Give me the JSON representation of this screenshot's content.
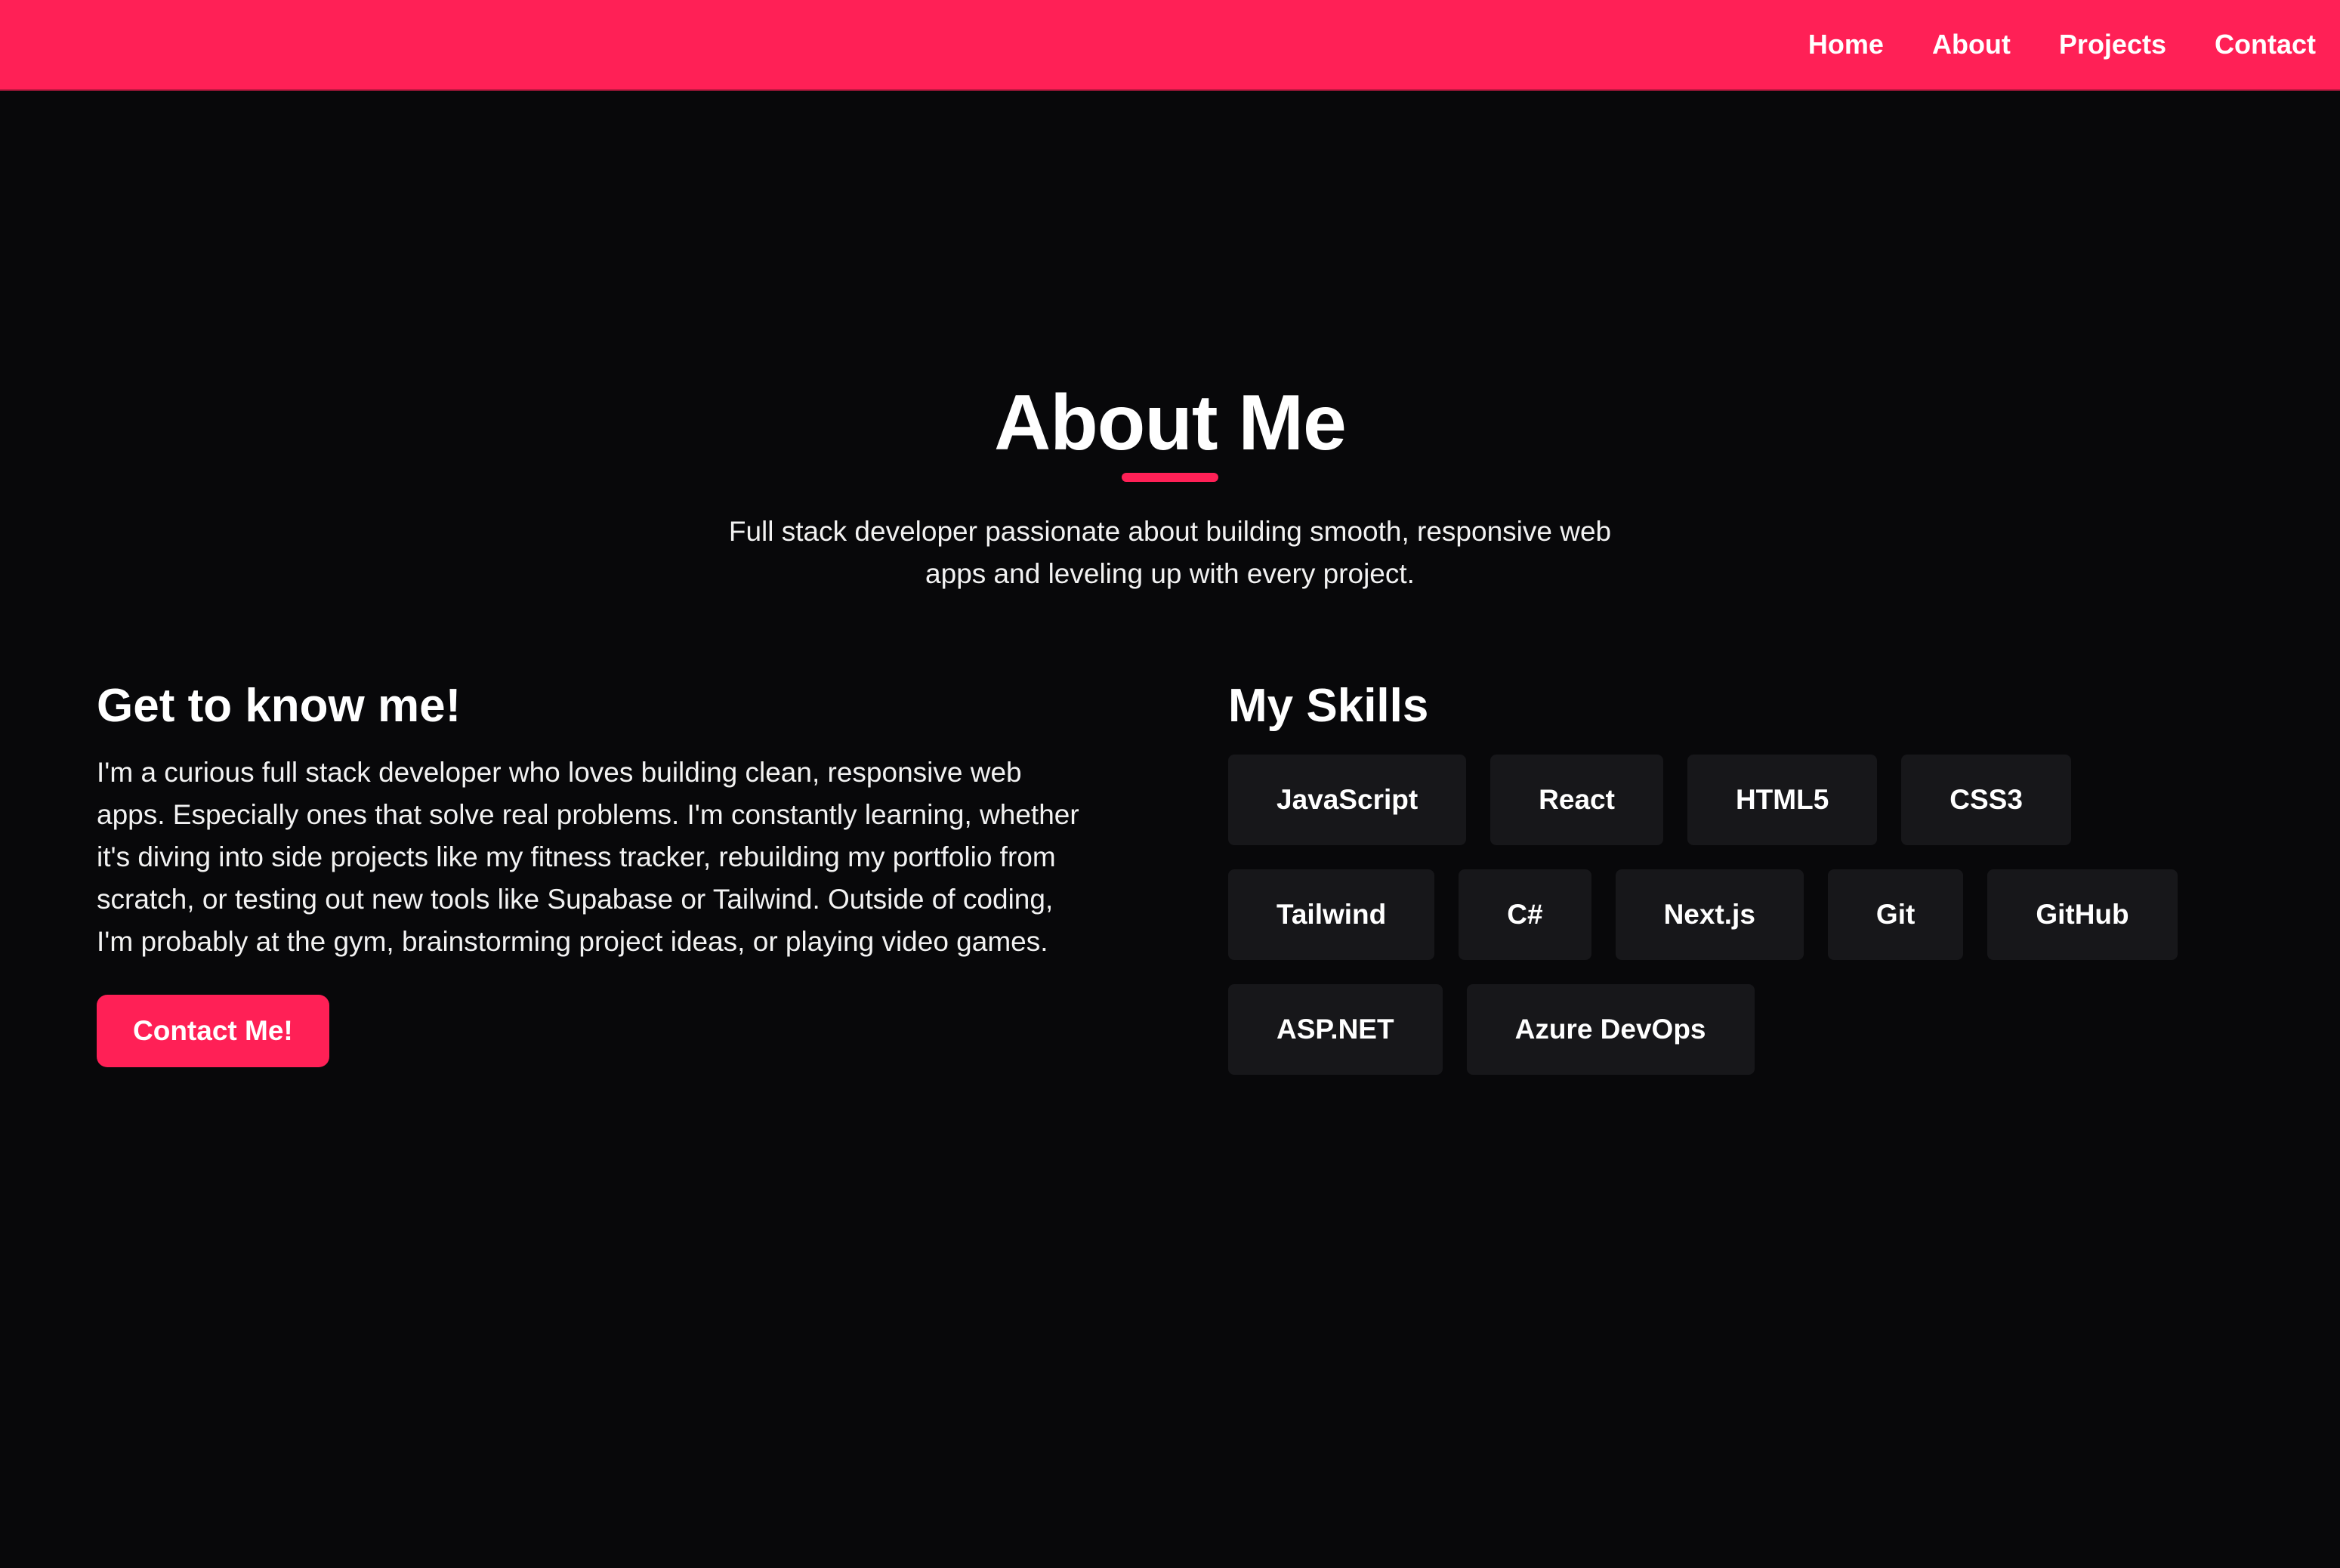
{
  "nav": {
    "links": [
      "Home",
      "About",
      "Projects",
      "Contact"
    ]
  },
  "hero": {
    "title": "About Me",
    "subtitle": "Full stack developer passionate about building smooth, responsive web apps and leveling up with every project."
  },
  "about": {
    "heading": "Get to know me!",
    "bio": "I'm a curious full stack developer who loves building clean, responsive web apps. Especially ones that solve real problems. I'm constantly learning, whether it's diving into side projects like my fitness tracker, rebuilding my portfolio from scratch, or testing out new tools like Supabase or Tailwind. Outside of coding, I'm probably at the gym, brainstorming project ideas, or playing video games.",
    "cta_label": "Contact Me!"
  },
  "skills": {
    "heading": "My Skills",
    "items": [
      "JavaScript",
      "React",
      "HTML5",
      "CSS3",
      "Tailwind",
      "C#",
      "Next.js",
      "Git",
      "GitHub",
      "ASP.NET",
      "Azure DevOps"
    ]
  },
  "colors": {
    "accent": "#ff2056",
    "background": "#08080a",
    "chip": "#17171a"
  }
}
